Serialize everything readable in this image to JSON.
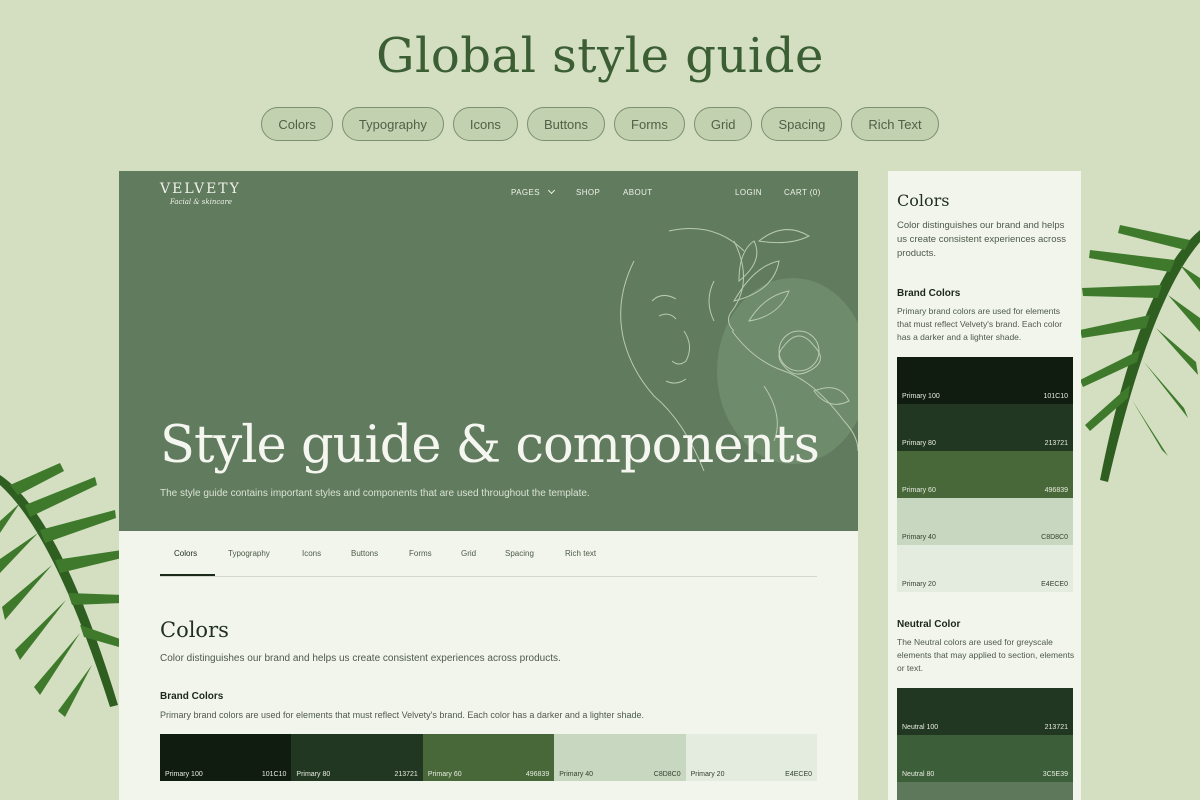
{
  "page_title": "Global style guide",
  "pills": [
    "Colors",
    "Typography",
    "Icons",
    "Buttons",
    "Forms",
    "Grid",
    "Spacing",
    "Rich Text"
  ],
  "site": {
    "logo": "VELVETY",
    "tagline": "Facial & skincare",
    "nav": {
      "pages": "PAGES",
      "shop": "SHOP",
      "about": "ABOUT",
      "login": "LOGIN",
      "cart": "CART (0)"
    },
    "hero_title": "Style guide & components",
    "hero_subtitle": "The style guide contains important styles and components that are used throughout the template.",
    "tabs": [
      "Colors",
      "Typography",
      "Icons",
      "Buttons",
      "Forms",
      "Grid",
      "Spacing",
      "Rich text"
    ],
    "section_title": "Colors",
    "section_desc": "Color distinguishes our brand and helps us create consistent experiences across products.",
    "brand_title": "Brand Colors",
    "brand_desc": "Primary brand colors are used for elements that must reflect Velvety's brand. Each color has a darker and a lighter shade.",
    "brand_swatches": [
      {
        "name": "Primary 100",
        "hex": "101C10",
        "color": "#101C10",
        "text": "#e7ece1"
      },
      {
        "name": "Primary 80",
        "hex": "213721",
        "color": "#213721",
        "text": "#e7ece1"
      },
      {
        "name": "Primary 60",
        "hex": "496839",
        "color": "#496839",
        "text": "#e7ece1"
      },
      {
        "name": "Primary 40",
        "hex": "C8D8C0",
        "color": "#C8D8C0",
        "text": "#33402e"
      },
      {
        "name": "Primary 20",
        "hex": "E4ECE0",
        "color": "#E4ECE0",
        "text": "#33402e"
      }
    ]
  },
  "panel": {
    "title": "Colors",
    "desc": "Color distinguishes our brand and helps us create consistent experiences across products.",
    "brand_title": "Brand Colors",
    "brand_desc": "Primary brand colors are used for elements that must reflect Velvety's brand. Each color has a darker and a lighter shade.",
    "brand_swatches": [
      {
        "name": "Primary 100",
        "hex": "101C10",
        "color": "#101C10",
        "text": "#e7ece1"
      },
      {
        "name": "Primary 80",
        "hex": "213721",
        "color": "#213721",
        "text": "#e7ece1"
      },
      {
        "name": "Primary 60",
        "hex": "496839",
        "color": "#496839",
        "text": "#e7ece1"
      },
      {
        "name": "Primary 40",
        "hex": "C8D8C0",
        "color": "#C8D8C0",
        "text": "#33402e"
      },
      {
        "name": "Primary 20",
        "hex": "E4ECE0",
        "color": "#E4ECE0",
        "text": "#33402e"
      }
    ],
    "neutral_title": "Neutral Color",
    "neutral_desc": "The Neutral colors are used for greyscale elements that may applied to section, elements or text.",
    "neutral_swatches": [
      {
        "name": "Neutral 100",
        "hex": "213721",
        "color": "#213721",
        "text": "#e7ece1"
      },
      {
        "name": "Neutral 80",
        "hex": "3C5E39",
        "color": "#3C5E39",
        "text": "#e7ece1"
      },
      {
        "name": "",
        "hex": "",
        "color": "#5d785a",
        "text": "#e7ece1"
      }
    ]
  }
}
